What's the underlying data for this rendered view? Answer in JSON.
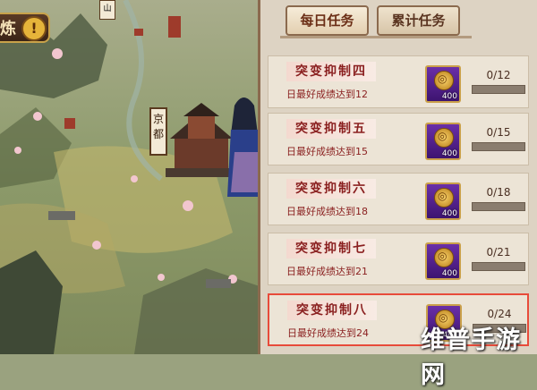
{
  "map": {
    "title_char": "炼",
    "warning_glyph": "!",
    "city_label": "京都",
    "mini_sign": "山"
  },
  "panel": {
    "tabs": [
      {
        "label": "每日任务",
        "active": true
      },
      {
        "label": "累计任务",
        "active": false
      }
    ],
    "tasks": [
      {
        "name": "突变抑制四",
        "desc": "日最好成绩达到12",
        "reward_amount": "400",
        "progress": "0/12",
        "progress_fraction": 0,
        "highlight": false
      },
      {
        "name": "突变抑制五",
        "desc": "日最好成绩达到15",
        "reward_amount": "400",
        "progress": "0/15",
        "progress_fraction": 0,
        "highlight": false
      },
      {
        "name": "突变抑制六",
        "desc": "日最好成绩达到18",
        "reward_amount": "400",
        "progress": "0/18",
        "progress_fraction": 0,
        "highlight": false
      },
      {
        "name": "突变抑制七",
        "desc": "日最好成绩达到21",
        "reward_amount": "400",
        "progress": "0/21",
        "progress_fraction": 0,
        "highlight": false
      },
      {
        "name": "突变抑制八",
        "desc": "日最好成绩达到24",
        "reward_amount": "400",
        "progress": "0/24",
        "progress_fraction": 0,
        "highlight": true
      }
    ]
  },
  "watermark": "维普手游网",
  "colors": {
    "task_text": "#8a1f1f",
    "highlight_border": "#e84b3a",
    "reward_purple": "#6a2fa8"
  }
}
